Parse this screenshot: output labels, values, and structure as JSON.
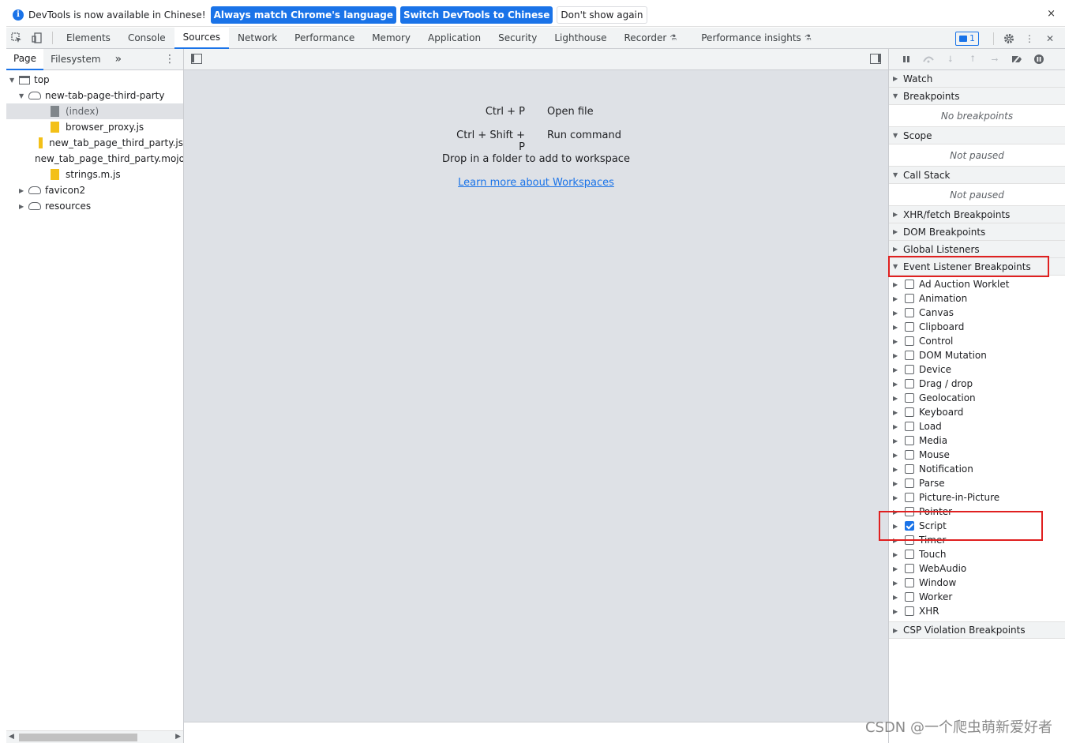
{
  "infobar": {
    "message": "DevTools is now available in Chinese!",
    "btn_match": "Always match Chrome's language",
    "btn_switch": "Switch DevTools to Chinese",
    "btn_dismiss": "Don't show again",
    "close": "×"
  },
  "toolbar": {
    "tabs": [
      "Elements",
      "Console",
      "Sources",
      "Network",
      "Performance",
      "Memory",
      "Application",
      "Security",
      "Lighthouse",
      "Recorder",
      "Performance insights"
    ],
    "active_tab": "Sources",
    "issues_count": "1"
  },
  "navigator": {
    "tabs": [
      "Page",
      "Filesystem"
    ],
    "more": "»",
    "tree": [
      {
        "label": "top",
        "indent": 0,
        "type": "frame",
        "expanded": true
      },
      {
        "label": "new-tab-page-third-party",
        "indent": 1,
        "type": "cloud",
        "expanded": true
      },
      {
        "label": "(index)",
        "indent": 2,
        "type": "file-gray",
        "selected": true
      },
      {
        "label": "browser_proxy.js",
        "indent": 2,
        "type": "file-yellow"
      },
      {
        "label": "new_tab_page_third_party.js",
        "indent": 2,
        "type": "file-yellow"
      },
      {
        "label": "new_tab_page_third_party.mojom-webui.js",
        "indent": 2,
        "type": "file-yellow"
      },
      {
        "label": "strings.m.js",
        "indent": 2,
        "type": "file-yellow"
      },
      {
        "label": "favicon2",
        "indent": 1,
        "type": "cloud",
        "expanded": false
      },
      {
        "label": "resources",
        "indent": 1,
        "type": "cloud",
        "expanded": false
      }
    ]
  },
  "editor": {
    "shortcuts": [
      {
        "keys": "Ctrl + P",
        "action": "Open file"
      },
      {
        "keys": "Ctrl + Shift + P",
        "action": "Run command"
      }
    ],
    "drop_text": "Drop in a folder to add to workspace",
    "learn_link": "Learn more about Workspaces"
  },
  "debugger": {
    "watch": "Watch",
    "breakpoints": "Breakpoints",
    "no_breakpoints": "No breakpoints",
    "scope": "Scope",
    "scope_status": "Not paused",
    "call_stack": "Call Stack",
    "call_stack_status": "Not paused",
    "xhr": "XHR/fetch Breakpoints",
    "dom": "DOM Breakpoints",
    "global": "Global Listeners",
    "event_listener": "Event Listener Breakpoints",
    "event_items": [
      {
        "label": "Ad Auction Worklet",
        "checked": false
      },
      {
        "label": "Animation",
        "checked": false
      },
      {
        "label": "Canvas",
        "checked": false
      },
      {
        "label": "Clipboard",
        "checked": false
      },
      {
        "label": "Control",
        "checked": false
      },
      {
        "label": "DOM Mutation",
        "checked": false
      },
      {
        "label": "Device",
        "checked": false
      },
      {
        "label": "Drag / drop",
        "checked": false
      },
      {
        "label": "Geolocation",
        "checked": false
      },
      {
        "label": "Keyboard",
        "checked": false
      },
      {
        "label": "Load",
        "checked": false
      },
      {
        "label": "Media",
        "checked": false
      },
      {
        "label": "Mouse",
        "checked": false
      },
      {
        "label": "Notification",
        "checked": false
      },
      {
        "label": "Parse",
        "checked": false
      },
      {
        "label": "Picture-in-Picture",
        "checked": false
      },
      {
        "label": "Pointer",
        "checked": false
      },
      {
        "label": "Script",
        "checked": true
      },
      {
        "label": "Timer",
        "checked": false
      },
      {
        "label": "Touch",
        "checked": false
      },
      {
        "label": "WebAudio",
        "checked": false
      },
      {
        "label": "Window",
        "checked": false
      },
      {
        "label": "Worker",
        "checked": false
      },
      {
        "label": "XHR",
        "checked": false
      }
    ],
    "csp": "CSP Violation Breakpoints"
  },
  "colors": {
    "accent": "#1a73e8",
    "annotation": "#e02020"
  },
  "watermark": "CSDN @一个爬虫萌新爱好者"
}
